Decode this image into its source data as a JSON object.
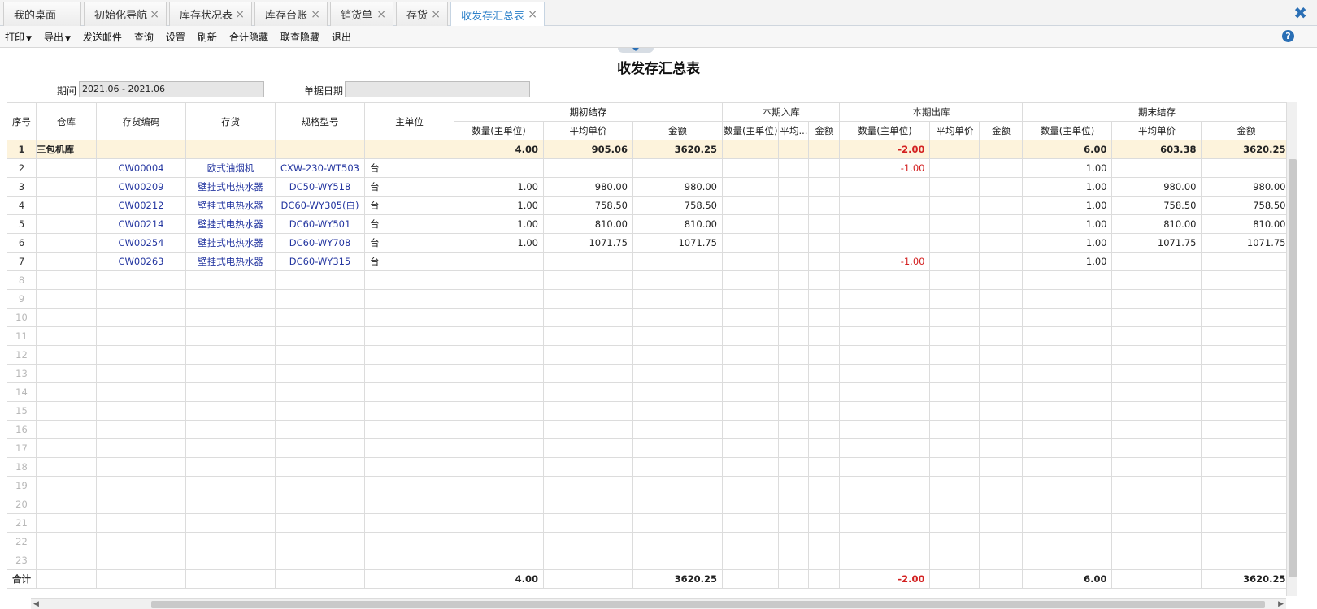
{
  "tabs": [
    {
      "label": "我的桌面",
      "closable": false
    },
    {
      "label": "初始化导航",
      "closable": true
    },
    {
      "label": "库存状况表",
      "closable": true
    },
    {
      "label": "库存台账",
      "closable": true
    },
    {
      "label": "销货单",
      "closable": true
    },
    {
      "label": "存货",
      "closable": true
    },
    {
      "label": "收发存汇总表",
      "closable": true,
      "active": true
    }
  ],
  "toolbar": {
    "print": "打印",
    "export": "导出",
    "send_mail": "发送邮件",
    "query": "查询",
    "settings": "设置",
    "refresh": "刷新",
    "hide_total": "合计隐藏",
    "hide_linked": "联查隐藏",
    "exit": "退出"
  },
  "report": {
    "title": "收发存汇总表",
    "period_label": "期间",
    "period_value": "2021.06 - 2021.06",
    "doc_date_label": "单据日期",
    "doc_date_value": ""
  },
  "columns": {
    "seq": "序号",
    "warehouse": "仓库",
    "item_code": "存货编码",
    "item": "存货",
    "spec": "规格型号",
    "unit": "主单位",
    "group_opening": "期初结存",
    "group_in": "本期入库",
    "group_out": "本期出库",
    "group_closing": "期末结存",
    "qty": "数量(主单位)",
    "avg_price": "平均单价",
    "amount": "金额",
    "in_qty": "数量(主单位)",
    "in_avg": "平均...",
    "in_amount": "金额",
    "out_qty": "数量(主单位)",
    "out_avg": "平均单价",
    "out_amount": "金额",
    "close_qty": "数量(主单位)",
    "close_avg": "平均单价",
    "close_amount": "金额"
  },
  "rows": [
    {
      "seq": "1",
      "warehouse": "三包机库",
      "code": "",
      "name": "",
      "spec": "",
      "unit": "",
      "open_qty": "4.00",
      "open_avg": "905.06",
      "open_amt": "3620.25",
      "out_qty": "-2.00",
      "close_qty": "6.00",
      "close_avg": "603.38",
      "close_amt": "3620.25",
      "group": true
    },
    {
      "seq": "2",
      "warehouse": "",
      "code": "CW00004",
      "name": "欧式油烟机",
      "spec": "CXW-230-WT503",
      "unit": "台",
      "open_qty": "",
      "open_avg": "",
      "open_amt": "",
      "out_qty": "-1.00",
      "close_qty": "1.00",
      "close_avg": "",
      "close_amt": ""
    },
    {
      "seq": "3",
      "warehouse": "",
      "code": "CW00209",
      "name": "壁挂式电热水器",
      "spec": "DC50-WY518",
      "unit": "台",
      "open_qty": "1.00",
      "open_avg": "980.00",
      "open_amt": "980.00",
      "out_qty": "",
      "close_qty": "1.00",
      "close_avg": "980.00",
      "close_amt": "980.00"
    },
    {
      "seq": "4",
      "warehouse": "",
      "code": "CW00212",
      "name": "壁挂式电热水器",
      "spec": "DC60-WY305(白)",
      "unit": "台",
      "open_qty": "1.00",
      "open_avg": "758.50",
      "open_amt": "758.50",
      "out_qty": "",
      "close_qty": "1.00",
      "close_avg": "758.50",
      "close_amt": "758.50"
    },
    {
      "seq": "5",
      "warehouse": "",
      "code": "CW00214",
      "name": "壁挂式电热水器",
      "spec": "DC60-WY501",
      "unit": "台",
      "open_qty": "1.00",
      "open_avg": "810.00",
      "open_amt": "810.00",
      "out_qty": "",
      "close_qty": "1.00",
      "close_avg": "810.00",
      "close_amt": "810.00"
    },
    {
      "seq": "6",
      "warehouse": "",
      "code": "CW00254",
      "name": "壁挂式电热水器",
      "spec": "DC60-WY708",
      "unit": "台",
      "open_qty": "1.00",
      "open_avg": "1071.75",
      "open_amt": "1071.75",
      "out_qty": "",
      "close_qty": "1.00",
      "close_avg": "1071.75",
      "close_amt": "1071.75"
    },
    {
      "seq": "7",
      "warehouse": "",
      "code": "CW00263",
      "name": "壁挂式电热水器",
      "spec": "DC60-WY315",
      "unit": "台",
      "open_qty": "",
      "open_avg": "",
      "open_amt": "",
      "out_qty": "-1.00",
      "close_qty": "1.00",
      "close_avg": "",
      "close_amt": ""
    }
  ],
  "empty_rows": [
    "8",
    "9",
    "10",
    "11",
    "12",
    "13",
    "14",
    "15",
    "16",
    "17",
    "18",
    "19",
    "20",
    "21",
    "22",
    "23"
  ],
  "totals": {
    "label": "合计",
    "open_qty": "4.00",
    "open_amt": "3620.25",
    "out_qty": "-2.00",
    "close_qty": "6.00",
    "close_amt": "3620.25"
  },
  "colors": {
    "accent": "#2a7fc8",
    "link": "#2436a0",
    "negative": "#d32020",
    "group_row_bg": "#fdf3dc"
  },
  "icons": {
    "close": "close-x-icon",
    "help": "help-icon",
    "dropdown": "caret-down-icon"
  }
}
